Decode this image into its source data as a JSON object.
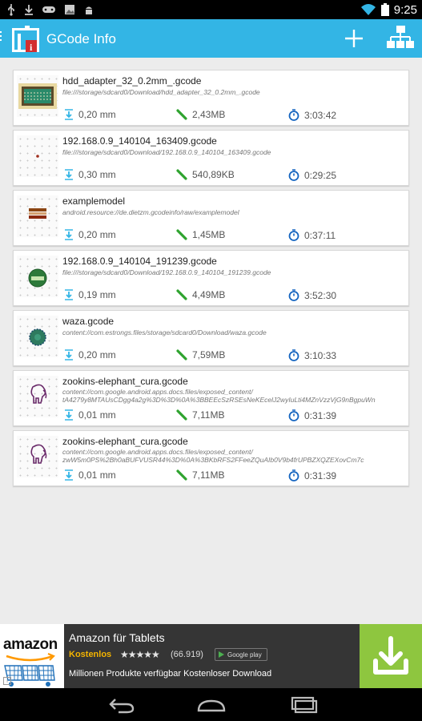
{
  "status_bar": {
    "time": "9:25",
    "left_icons": [
      "usb-icon",
      "download-icon",
      "gamepad-icon",
      "image-icon",
      "android-icon"
    ],
    "right_icons": [
      "wifi-icon",
      "battery-icon"
    ]
  },
  "action_bar": {
    "title": "GCode Info",
    "color": "#33b5e5",
    "actions": [
      "add-icon",
      "tree-icon"
    ]
  },
  "files": [
    {
      "name": "hdd_adapter_32_0.2mm_.gcode",
      "path": "file:///storage/sdcard0/Download/hdd_adapter_32_0.2mm_.gcode",
      "layer": "0,20 mm",
      "size": "2,43MB",
      "time": "3:03:42",
      "thumb": "hdd-adapter-thumbnail"
    },
    {
      "name": "192.168.0.9_140104_163409.gcode",
      "path": "file:///storage/sdcard0/Download/192.168.0.9_140104_163409.gcode",
      "layer": "0,30 mm",
      "size": "540,89KB",
      "time": "0:29:25",
      "thumb": "dot-thumbnail"
    },
    {
      "name": "examplemodel",
      "path": "android.resource://de.dietzm.gcodeinfo/raw/examplemodel",
      "layer": "0,20 mm",
      "size": "1,45MB",
      "time": "0:37:11",
      "thumb": "bar-thumbnail"
    },
    {
      "name": "192.168.0.9_140104_191239.gcode",
      "path": "file:///storage/sdcard0/Download/192.168.0.9_140104_191239.gcode",
      "layer": "0,19 mm",
      "size": "4,49MB",
      "time": "3:52:30",
      "thumb": "green-ball-thumbnail"
    },
    {
      "name": "waza.gcode",
      "path": "content://com.estrongs.files/storage/sdcard0/Download/waza.gcode",
      "layer": "0,20 mm",
      "size": "7,59MB",
      "time": "3:10:33",
      "thumb": "waza-thumbnail"
    },
    {
      "name": "zookins-elephant_cura.gcode",
      "path": "content://com.google.android.apps.docs.files/exposed_content/",
      "path2": "tA4279y8MTAUsCDgg4a2g%3D%3D%0A%3BBEEcSzRSEsNeKEcelJ2wyIuLti4MZnVzzVjG9nBgpuWn",
      "layer": "0,01 mm",
      "size": "7,11MB",
      "time": "0:31:39",
      "thumb": "elephant-thumbnail"
    },
    {
      "name": "zookins-elephant_cura.gcode",
      "path": "content://com.google.android.apps.docs.files/exposed_content/",
      "path2": "zwW5m0PS%2Bh0aBUFVUSR44%3D%0A%3BKbRFS2FFeeZQuAIb0V9b4frUPBZXQZEXovCm7c",
      "layer": "0,01 mm",
      "size": "7,11MB",
      "time": "0:31:39",
      "thumb": "elephant-thumbnail"
    }
  ],
  "ad": {
    "logo": "amazon",
    "title": "Amazon für Tablets",
    "price": "Kostenlos",
    "stars": "★★★★★",
    "rating_count": "(66.919)",
    "store": "Google play",
    "description": "Millionen Produkte verfügbar Kostenloser Download",
    "download_color": "#8ec63f",
    "info": "i"
  },
  "nav_bar": {
    "buttons": [
      "back-icon",
      "home-icon",
      "recents-icon"
    ]
  }
}
